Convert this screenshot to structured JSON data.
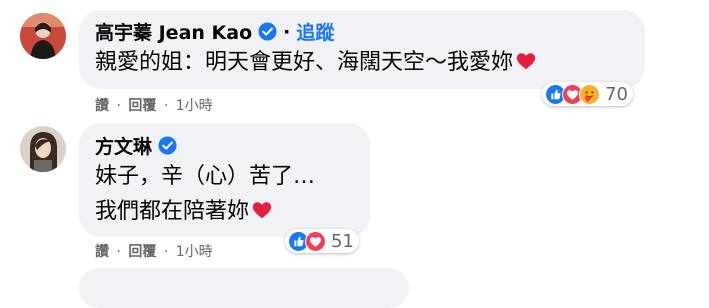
{
  "comments": [
    {
      "author": "高宇蓁 Jean Kao",
      "follow_label": "追蹤",
      "lines": [
        "親愛的姐：明天會更好、海闊天空～我愛妳"
      ],
      "actions": {
        "like": "讚",
        "reply": "回覆",
        "time": "1小時",
        "sep": "·"
      },
      "reaction_count": "70",
      "reaction_icons": [
        "like-reaction-icon",
        "love-reaction-icon",
        "care-reaction-icon"
      ]
    },
    {
      "author": "方文琳",
      "lines": [
        "妹子，辛（心）苦了…",
        "我們都在陪著妳"
      ],
      "actions": {
        "like": "讚",
        "reply": "回覆",
        "time": "1小時",
        "sep": "·"
      },
      "reaction_count": "51",
      "reaction_icons": [
        "like-reaction-icon",
        "love-reaction-icon"
      ]
    }
  ],
  "colors": {
    "link": "#1877f2",
    "bubble": "#f0f2f5",
    "meta": "#65676b",
    "heart": "#e41e3f"
  }
}
